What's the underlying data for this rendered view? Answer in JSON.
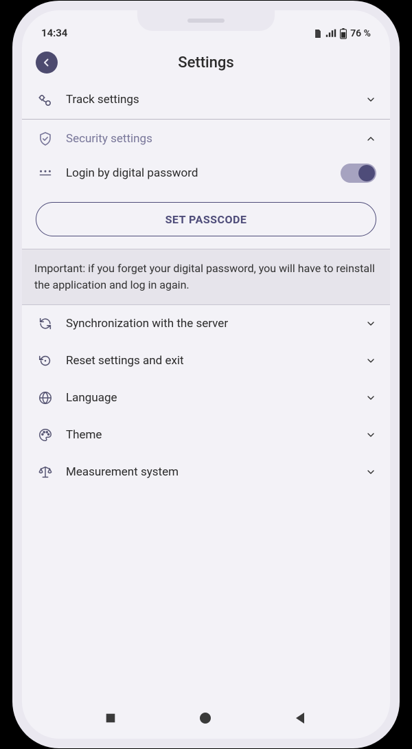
{
  "statusbar": {
    "time": "14:34",
    "battery_pct": "76 %"
  },
  "header": {
    "title": "Settings"
  },
  "rows": {
    "track": {
      "label": "Track settings"
    },
    "security": {
      "label": "Security settings",
      "login_label": "Login by digital password",
      "button_label": "SET PASSCODE",
      "warning": "Important: if you forget your digital password, you will have to reinstall the application and log in again."
    },
    "sync": {
      "label": "Synchronization with the server"
    },
    "reset": {
      "label": "Reset settings and exit"
    },
    "language": {
      "label": "Language"
    },
    "theme": {
      "label": "Theme"
    },
    "measure": {
      "label": "Measurement system"
    }
  }
}
